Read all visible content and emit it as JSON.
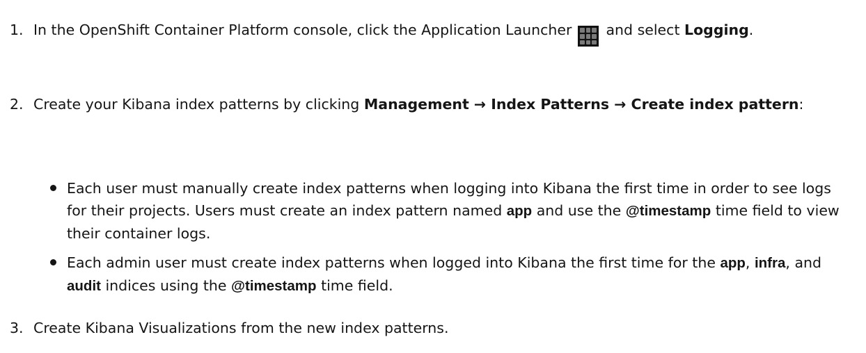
{
  "steps": [
    {
      "number": "1.",
      "text_before_icon": "In the OpenShift Container Platform console, click the Application Launcher",
      "icon": "application-launcher-grid-icon",
      "text_after_icon": " and select ",
      "gui_item": "Logging",
      "end": "."
    },
    {
      "number": "2.",
      "text_before": "Create your Kibana index patterns by clicking ",
      "menu_path": "Management → Index Patterns → Create index pattern",
      "end": ":",
      "bullets": [
        {
          "p1": "Each user must manually create index patterns when logging into Kibana the first time in order to see logs for their projects. Users must create an index pattern named ",
          "b1": "app",
          "p2": " and use the ",
          "b2": "@timestamp",
          "p3": " time field to view their container logs."
        },
        {
          "p1": "Each admin user must create index patterns when logged into Kibana the first time for the ",
          "b1": "app",
          "p2": ", ",
          "b2": "infra",
          "p3": ", and ",
          "b3": "audit",
          "p4": " indices using the ",
          "b4": "@timestamp",
          "p5": " time field."
        }
      ]
    },
    {
      "number": "3.",
      "text": "Create Kibana Visualizations from the new index patterns."
    }
  ]
}
